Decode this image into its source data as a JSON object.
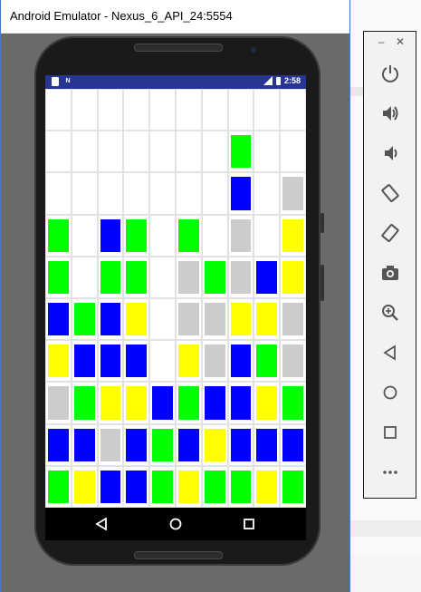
{
  "window": {
    "title": "Android Emulator - Nexus_6_API_24:5554"
  },
  "statusbar": {
    "time": "2:58",
    "left_icons": [
      "sd-card-icon",
      "n-notification-icon"
    ],
    "right_icons": [
      "signal-icon",
      "battery-icon"
    ]
  },
  "colors": {
    "green": "#00ff00",
    "blue": "#0000ff",
    "yellow": "#ffff00",
    "gray": "#cccccc",
    "empty": "#ffffff",
    "statusbar": "#283593"
  },
  "board": {
    "columns": 10,
    "rows": 10,
    "cells": [
      [
        "empty",
        "empty",
        "empty",
        "empty",
        "empty",
        "empty",
        "empty",
        "empty",
        "empty",
        "empty"
      ],
      [
        "empty",
        "empty",
        "empty",
        "empty",
        "empty",
        "empty",
        "empty",
        "green",
        "empty",
        "empty"
      ],
      [
        "empty",
        "empty",
        "empty",
        "empty",
        "empty",
        "empty",
        "empty",
        "blue",
        "empty",
        "gray"
      ],
      [
        "green",
        "empty",
        "blue",
        "green",
        "empty",
        "green",
        "empty",
        "gray",
        "empty",
        "yellow"
      ],
      [
        "green",
        "empty",
        "green",
        "green",
        "empty",
        "gray",
        "green",
        "gray",
        "blue",
        "yellow"
      ],
      [
        "blue",
        "green",
        "blue",
        "yellow",
        "empty",
        "gray",
        "gray",
        "yellow",
        "yellow",
        "gray"
      ],
      [
        "yellow",
        "blue",
        "blue",
        "blue",
        "empty",
        "yellow",
        "gray",
        "blue",
        "green",
        "gray"
      ],
      [
        "gray",
        "green",
        "yellow",
        "yellow",
        "blue",
        "green",
        "blue",
        "blue",
        "yellow",
        "green"
      ],
      [
        "blue",
        "blue",
        "gray",
        "blue",
        "green",
        "blue",
        "yellow",
        "blue",
        "blue",
        "blue"
      ],
      [
        "green",
        "yellow",
        "blue",
        "blue",
        "green",
        "yellow",
        "green",
        "green",
        "yellow",
        "green"
      ]
    ]
  },
  "navbar": {
    "buttons": [
      "back-icon",
      "home-icon",
      "recents-icon"
    ]
  },
  "toolbar": {
    "window_controls": [
      "minimize-icon",
      "close-icon"
    ],
    "buttons": [
      "power-icon",
      "volume-up-icon",
      "volume-down-icon",
      "rotate-left-icon",
      "rotate-right-icon",
      "camera-icon",
      "zoom-icon",
      "back-icon",
      "home-icon",
      "overview-icon",
      "more-icon"
    ]
  }
}
